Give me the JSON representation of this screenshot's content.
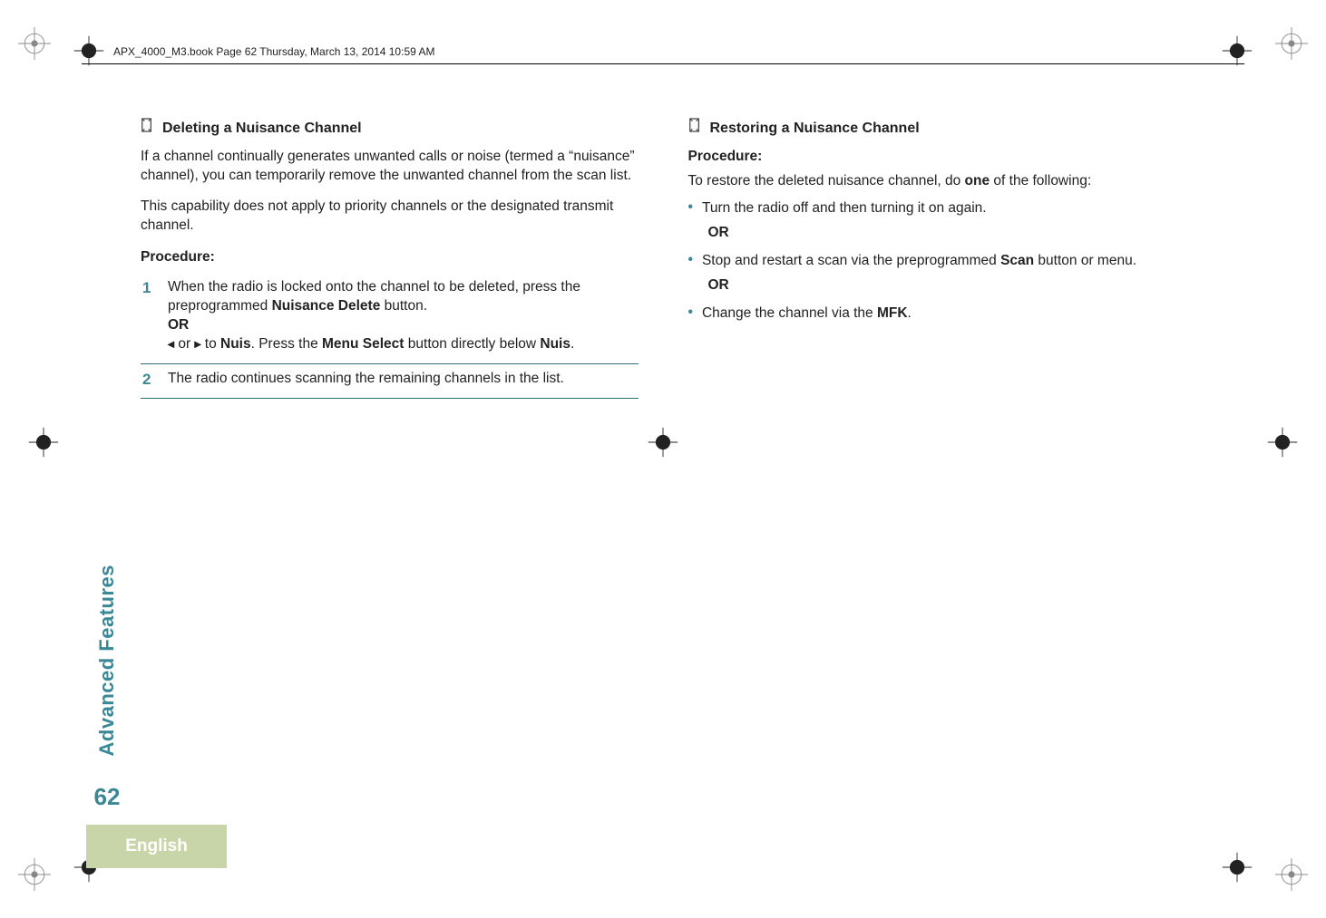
{
  "header_runner": "APX_4000_M3.book  Page 62  Thursday, March 13, 2014  10:59 AM",
  "sidebar": {
    "section": "Advanced Features",
    "page_number": "62",
    "language": "English"
  },
  "left": {
    "title": "Deleting a Nuisance Channel",
    "intro1": "If a channel continually generates unwanted calls or noise (termed a “nuisance” channel), you can temporarily remove the unwanted channel from the scan list.",
    "intro2": "This capability does not apply to priority channels or the designated transmit channel.",
    "procedure_label": "Procedure:",
    "step1": {
      "num": "1",
      "line_a_pre": "When the radio is locked onto the channel to be deleted, press the preprogrammed ",
      "line_a_bold": "Nuisance Delete",
      "line_a_post": " button.",
      "or": "OR",
      "line_b_pre_glyphs": "◂ or ▸ to ",
      "line_b_nuis": "Nuis",
      "line_b_mid": ". Press the ",
      "line_b_bold": "Menu Select",
      "line_b_post1": " button directly below ",
      "line_b_nuis2": "Nuis",
      "line_b_post2": "."
    },
    "step2": {
      "num": "2",
      "text": "The radio continues scanning the remaining channels in the list."
    }
  },
  "right": {
    "title": "Restoring a Nuisance Channel",
    "procedure_label": "Procedure:",
    "intro_pre": "To restore the deleted nuisance channel, do ",
    "intro_bold": "one",
    "intro_post": " of the following:",
    "bullet1": "Turn the radio off and then turning it on again.",
    "or1": "OR",
    "bullet2_pre": "Stop and restart a scan via the preprogrammed ",
    "bullet2_bold": "Scan",
    "bullet2_post": " button or menu.",
    "or2": "OR",
    "bullet3_pre": "Change the channel via the ",
    "bullet3_bold": "MFK",
    "bullet3_post": "."
  }
}
